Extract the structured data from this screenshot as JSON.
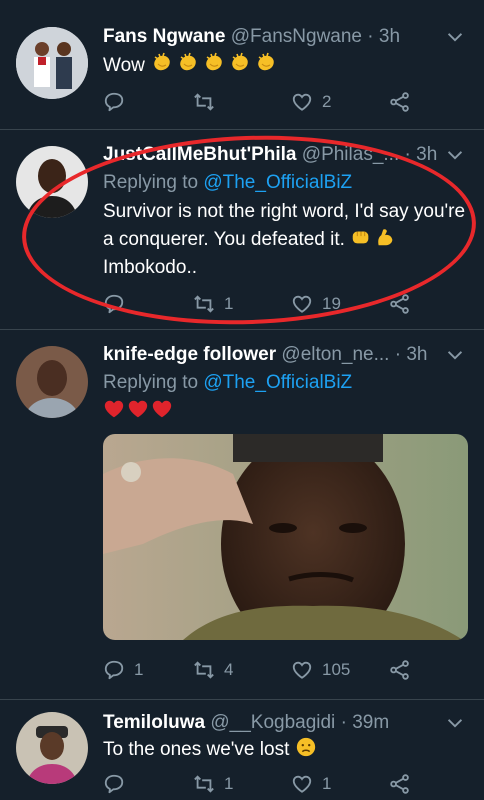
{
  "tweets": [
    {
      "name": "Fans Ngwane",
      "handle": "@FansNgwane",
      "time": "3h",
      "text": "Wow",
      "actions": {
        "replies": "",
        "retweets": "",
        "likes": "2"
      }
    },
    {
      "name": "JustCallMeBhut'Phila",
      "handle": "@Philas_...",
      "time": "3h",
      "replying_label": "Replying to",
      "replying_to": "@The_OfficialBiZ",
      "text": "Survivor is not the right word, I'd say you're a conquerer. You defeated it.",
      "text2": "Imbokodo..",
      "actions": {
        "replies": "",
        "retweets": "1",
        "likes": "19"
      }
    },
    {
      "name": "knife-edge follower",
      "handle": "@elton_ne...",
      "time": "3h",
      "replying_label": "Replying to",
      "replying_to": "@The_OfficialBiZ",
      "actions": {
        "replies": "1",
        "retweets": "4",
        "likes": "105"
      }
    },
    {
      "name": "Temiloluwa",
      "handle": "@__Kogbagidi",
      "time": "39m",
      "text": "To the ones we've lost",
      "actions": {
        "replies": "",
        "retweets": "1",
        "likes": "1"
      }
    }
  ],
  "separator": "·",
  "colors": {
    "background": "#15202b",
    "secondary_text": "#8899a6",
    "link": "#1da1f2",
    "annotation": "#e8282b"
  },
  "icons": [
    "reply-icon",
    "retweet-icon",
    "heart-icon",
    "share-icon",
    "chevron-down-icon",
    "clap-emoji",
    "heart-emoji",
    "flexed-biceps-emoji",
    "fist-emoji",
    "sad-face-emoji"
  ]
}
